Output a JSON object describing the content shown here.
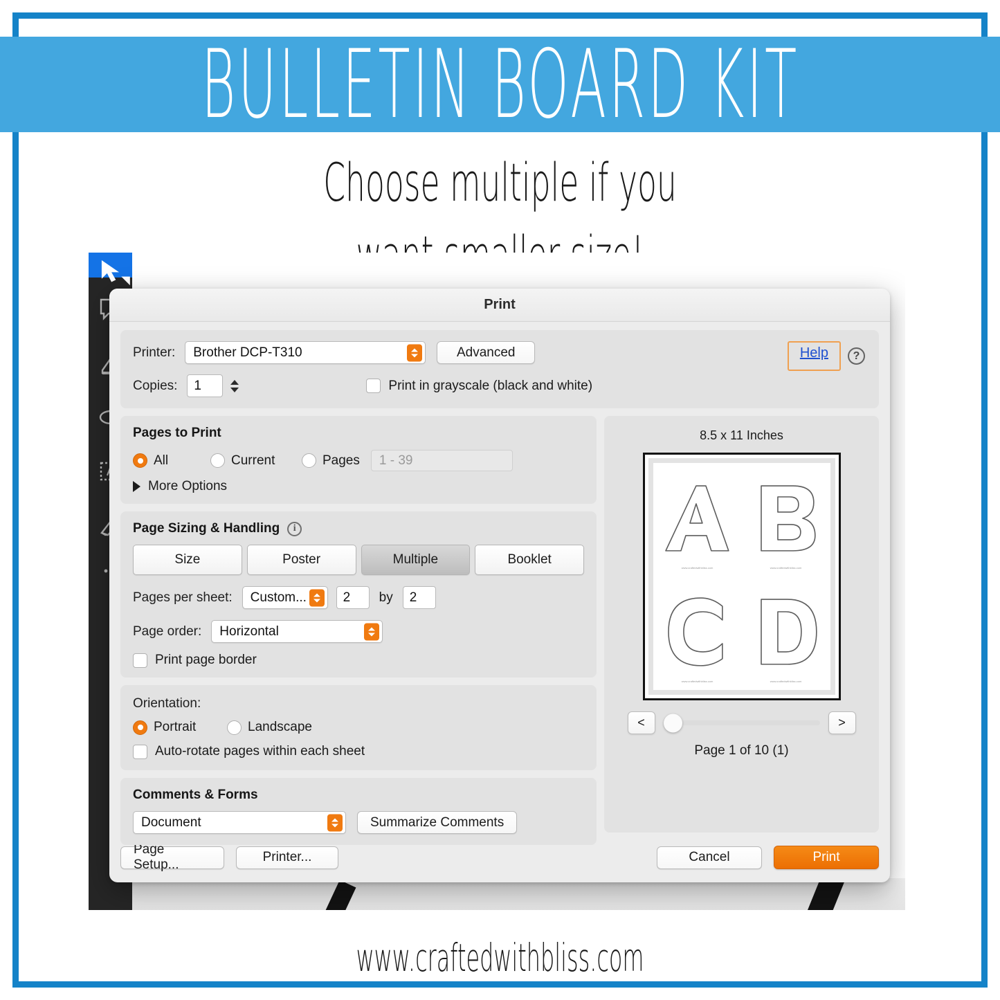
{
  "banner": {
    "title": "BULLETIN BOARD KIT"
  },
  "subtitle": {
    "line1": "Choose multiple if you",
    "line2": "want smaller size!"
  },
  "footer": {
    "url": "www.craftedwithbliss.com"
  },
  "colors": {
    "banner_blue": "#43a7df",
    "frame_blue": "#1583c8",
    "accent_orange": "#f07a10",
    "print_button_orange": "#ec6f03",
    "help_link_blue": "#1f50d0",
    "focus_ring_orange": "#f0a050"
  },
  "dialog": {
    "title": "Print",
    "printer_section": {
      "printer_label": "Printer:",
      "printer_value": "Brother DCP-T310",
      "advanced_label": "Advanced",
      "help_label": "Help",
      "help_question_icon": "?",
      "copies_label": "Copies:",
      "copies_value": "1",
      "grayscale_label": "Print in grayscale (black and white)",
      "grayscale_checked": false
    },
    "pages_to_print": {
      "title": "Pages to Print",
      "options": [
        {
          "label": "All",
          "selected": true
        },
        {
          "label": "Current",
          "selected": false
        },
        {
          "label": "Pages",
          "selected": false
        }
      ],
      "pages_placeholder": "1 - 39",
      "more_options_label": "More Options"
    },
    "page_sizing": {
      "title": "Page Sizing & Handling",
      "info_icon": "i",
      "segments": [
        {
          "label": "Size",
          "active": false
        },
        {
          "label": "Poster",
          "active": false
        },
        {
          "label": "Multiple",
          "active": true
        },
        {
          "label": "Booklet",
          "active": false
        }
      ],
      "pages_per_sheet_label": "Pages per sheet:",
      "pages_per_sheet_value": "Custom...",
      "grid_cols": "2",
      "by_label": "by",
      "grid_rows": "2",
      "page_order_label": "Page order:",
      "page_order_value": "Horizontal",
      "print_page_border_label": "Print page border",
      "print_page_border_checked": false
    },
    "orientation": {
      "label": "Orientation:",
      "options": [
        {
          "label": "Portrait",
          "selected": true
        },
        {
          "label": "Landscape",
          "selected": false
        }
      ],
      "auto_rotate_label": "Auto-rotate pages within each sheet",
      "auto_rotate_checked": false
    },
    "comments_forms": {
      "title": "Comments & Forms",
      "value": "Document",
      "summarize_label": "Summarize Comments"
    },
    "preview": {
      "paper_size": "8.5 x 11 Inches",
      "letters": [
        "A",
        "B",
        "C",
        "D"
      ],
      "caption": "www.craftedwithbliss.com",
      "prev_label": "<",
      "next_label": ">",
      "page_indicator": "Page 1 of 10 (1)",
      "slider_position_percent": 0
    },
    "footer_buttons": {
      "page_setup": "Page Setup...",
      "printer": "Printer...",
      "cancel": "Cancel",
      "print": "Print"
    }
  }
}
